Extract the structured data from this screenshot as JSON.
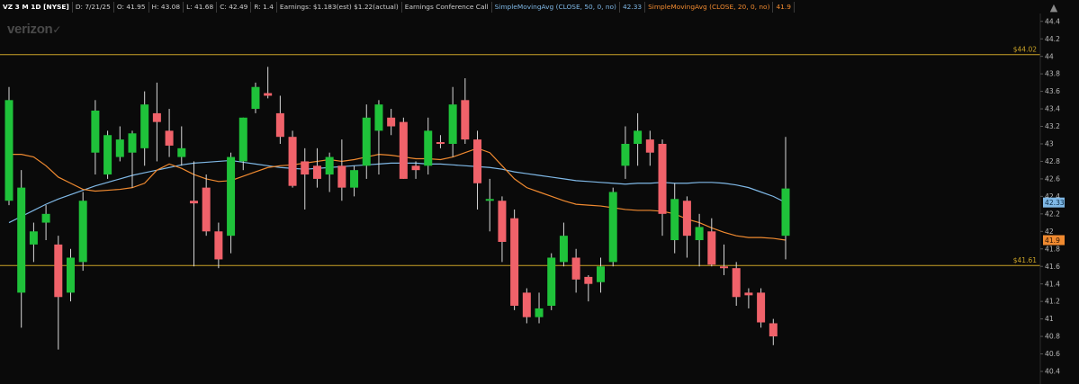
{
  "header": {
    "symbol": "VZ 3 M 1D [NYSE]",
    "date": "D: 7/21/25",
    "open": "O: 41.95",
    "high": "H: 43.08",
    "low": "L: 41.68",
    "close": "C: 42.49",
    "range": "R: 1.4",
    "earnings": "Earnings: $1.183(est) $1.22(actual)",
    "conference": "Earnings Conference Call",
    "sma50_label": "SimpleMovingAvg (CLOSE, 50, 0, no)",
    "sma50_value": "42.33",
    "sma20_label": "SimpleMovingAvg (CLOSE, 20, 0, no)",
    "sma20_value": "41.9"
  },
  "logo": {
    "text": "verizon",
    "mark": "✓"
  },
  "colors": {
    "up": "#1fc23a",
    "down": "#f0626a",
    "sma50": "#7fb8e6",
    "sma20": "#f08a30",
    "level": "#c9a227",
    "background": "#0a0a0a",
    "axis_text": "#b8b8b8"
  },
  "chart_data": {
    "type": "candlestick",
    "ylim": [
      40.4,
      44.5
    ],
    "y_ticks": [
      "44.4",
      "44.2",
      "44",
      "43.8",
      "43.6",
      "43.4",
      "43.2",
      "43",
      "42.8",
      "42.6",
      "42.4",
      "42.2",
      "42",
      "41.8",
      "41.6",
      "41.4",
      "41.2",
      "41",
      "40.8",
      "40.6",
      "40.4"
    ],
    "horizontal_lines": [
      {
        "value": 44.02,
        "label": "$44.02"
      },
      {
        "value": 41.61,
        "label": "$41.61"
      }
    ],
    "last_value_labels": [
      {
        "value": 42.33,
        "label": "42.33",
        "series": "sma50"
      },
      {
        "value": 41.9,
        "label": "41.9",
        "series": "sma20"
      }
    ],
    "candles": [
      {
        "o": 42.35,
        "h": 43.65,
        "l": 42.3,
        "c": 43.5
      },
      {
        "o": 41.3,
        "h": 42.7,
        "l": 40.9,
        "c": 42.5
      },
      {
        "o": 41.85,
        "h": 42.1,
        "l": 41.65,
        "c": 42.0
      },
      {
        "o": 42.1,
        "h": 42.3,
        "l": 41.9,
        "c": 42.2
      },
      {
        "o": 41.85,
        "h": 41.95,
        "l": 40.65,
        "c": 41.25
      },
      {
        "o": 41.3,
        "h": 41.8,
        "l": 41.2,
        "c": 41.7
      },
      {
        "o": 41.65,
        "h": 42.45,
        "l": 41.55,
        "c": 42.35
      },
      {
        "o": 42.9,
        "h": 43.5,
        "l": 42.65,
        "c": 43.38
      },
      {
        "o": 42.65,
        "h": 43.15,
        "l": 42.6,
        "c": 43.1
      },
      {
        "o": 42.85,
        "h": 43.2,
        "l": 42.8,
        "c": 43.05
      },
      {
        "o": 42.9,
        "h": 43.15,
        "l": 42.5,
        "c": 43.12
      },
      {
        "o": 42.95,
        "h": 43.6,
        "l": 42.75,
        "c": 43.45
      },
      {
        "o": 43.35,
        "h": 43.7,
        "l": 42.8,
        "c": 43.25
      },
      {
        "o": 43.15,
        "h": 43.4,
        "l": 42.85,
        "c": 42.98
      },
      {
        "o": 42.85,
        "h": 43.2,
        "l": 42.75,
        "c": 42.95
      },
      {
        "o": 42.35,
        "h": 42.8,
        "l": 41.6,
        "c": 42.32
      },
      {
        "o": 42.5,
        "h": 42.65,
        "l": 41.95,
        "c": 42.0
      },
      {
        "o": 42.0,
        "h": 42.1,
        "l": 41.58,
        "c": 41.68
      },
      {
        "o": 41.95,
        "h": 42.9,
        "l": 41.75,
        "c": 42.85
      },
      {
        "o": 42.8,
        "h": 43.3,
        "l": 42.7,
        "c": 43.3
      },
      {
        "o": 43.4,
        "h": 43.7,
        "l": 43.35,
        "c": 43.65
      },
      {
        "o": 43.58,
        "h": 43.88,
        "l": 43.52,
        "c": 43.55
      },
      {
        "o": 43.35,
        "h": 43.55,
        "l": 43.0,
        "c": 43.08
      },
      {
        "o": 43.08,
        "h": 43.15,
        "l": 42.5,
        "c": 42.52
      },
      {
        "o": 42.8,
        "h": 42.95,
        "l": 42.25,
        "c": 42.65
      },
      {
        "o": 42.75,
        "h": 42.95,
        "l": 42.5,
        "c": 42.6
      },
      {
        "o": 42.65,
        "h": 42.9,
        "l": 42.45,
        "c": 42.85
      },
      {
        "o": 42.75,
        "h": 43.05,
        "l": 42.35,
        "c": 42.5
      },
      {
        "o": 42.5,
        "h": 42.75,
        "l": 42.4,
        "c": 42.7
      },
      {
        "o": 42.75,
        "h": 43.45,
        "l": 42.6,
        "c": 43.3
      },
      {
        "o": 43.15,
        "h": 43.5,
        "l": 42.65,
        "c": 43.45
      },
      {
        "o": 43.3,
        "h": 43.4,
        "l": 43.1,
        "c": 43.2
      },
      {
        "o": 43.25,
        "h": 43.3,
        "l": 42.6,
        "c": 42.6
      },
      {
        "o": 42.75,
        "h": 42.8,
        "l": 42.6,
        "c": 42.7
      },
      {
        "o": 42.75,
        "h": 43.3,
        "l": 42.65,
        "c": 43.15
      },
      {
        "o": 43.02,
        "h": 43.1,
        "l": 42.95,
        "c": 43.0
      },
      {
        "o": 43.0,
        "h": 43.65,
        "l": 42.85,
        "c": 43.45
      },
      {
        "o": 43.5,
        "h": 43.75,
        "l": 43.0,
        "c": 43.05
      },
      {
        "o": 43.05,
        "h": 43.15,
        "l": 42.25,
        "c": 42.55
      },
      {
        "o": 42.35,
        "h": 42.6,
        "l": 42.0,
        "c": 42.37
      },
      {
        "o": 42.35,
        "h": 42.4,
        "l": 41.65,
        "c": 41.88
      },
      {
        "o": 42.15,
        "h": 42.25,
        "l": 41.1,
        "c": 41.15
      },
      {
        "o": 41.3,
        "h": 41.35,
        "l": 40.95,
        "c": 41.02
      },
      {
        "o": 41.02,
        "h": 41.3,
        "l": 40.95,
        "c": 41.12
      },
      {
        "o": 41.15,
        "h": 41.75,
        "l": 41.1,
        "c": 41.7
      },
      {
        "o": 41.65,
        "h": 42.1,
        "l": 41.6,
        "c": 41.95
      },
      {
        "o": 41.7,
        "h": 41.8,
        "l": 41.3,
        "c": 41.45
      },
      {
        "o": 41.48,
        "h": 41.5,
        "l": 41.2,
        "c": 41.4
      },
      {
        "o": 41.42,
        "h": 41.7,
        "l": 41.3,
        "c": 41.6
      },
      {
        "o": 41.65,
        "h": 42.5,
        "l": 41.6,
        "c": 42.45
      },
      {
        "o": 42.75,
        "h": 43.2,
        "l": 42.6,
        "c": 43.0
      },
      {
        "o": 43.0,
        "h": 43.35,
        "l": 42.75,
        "c": 43.15
      },
      {
        "o": 43.05,
        "h": 43.15,
        "l": 42.75,
        "c": 42.9
      },
      {
        "o": 43.0,
        "h": 43.05,
        "l": 41.95,
        "c": 42.2
      },
      {
        "o": 41.9,
        "h": 42.55,
        "l": 41.75,
        "c": 42.37
      },
      {
        "o": 42.35,
        "h": 42.4,
        "l": 41.7,
        "c": 41.95
      },
      {
        "o": 41.9,
        "h": 42.2,
        "l": 41.6,
        "c": 42.05
      },
      {
        "o": 42.0,
        "h": 42.15,
        "l": 41.6,
        "c": 41.62
      },
      {
        "o": 41.6,
        "h": 41.85,
        "l": 41.5,
        "c": 41.58
      },
      {
        "o": 41.58,
        "h": 41.65,
        "l": 41.15,
        "c": 41.25
      },
      {
        "o": 41.3,
        "h": 41.35,
        "l": 41.12,
        "c": 41.27
      },
      {
        "o": 41.3,
        "h": 41.35,
        "l": 40.9,
        "c": 40.96
      },
      {
        "o": 40.95,
        "h": 41.0,
        "l": 40.7,
        "c": 40.8
      },
      {
        "o": 41.95,
        "h": 43.08,
        "l": 41.68,
        "c": 42.49
      }
    ],
    "sma50": [
      42.1,
      42.17,
      42.24,
      42.31,
      42.37,
      42.42,
      42.47,
      42.52,
      42.56,
      42.6,
      42.64,
      42.67,
      42.7,
      42.73,
      42.76,
      42.78,
      42.79,
      42.8,
      42.81,
      42.79,
      42.77,
      42.75,
      42.73,
      42.72,
      42.71,
      42.72,
      42.73,
      42.74,
      42.75,
      42.76,
      42.77,
      42.78,
      42.78,
      42.78,
      42.77,
      42.77,
      42.76,
      42.75,
      42.74,
      42.73,
      42.71,
      42.68,
      42.66,
      42.64,
      42.62,
      42.6,
      42.58,
      42.57,
      42.56,
      42.55,
      42.54,
      42.55,
      42.55,
      42.56,
      42.55,
      42.55,
      42.56,
      42.56,
      42.55,
      42.53,
      42.5,
      42.45,
      42.4,
      42.33
    ],
    "sma20": [
      42.88,
      42.88,
      42.85,
      42.75,
      42.62,
      42.55,
      42.48,
      42.46,
      42.47,
      42.48,
      42.5,
      42.55,
      42.7,
      42.77,
      42.72,
      42.65,
      42.6,
      42.57,
      42.58,
      42.63,
      42.68,
      42.73,
      42.75,
      42.76,
      42.78,
      42.8,
      42.82,
      42.8,
      42.82,
      42.85,
      42.88,
      42.87,
      42.85,
      42.83,
      42.83,
      42.82,
      42.85,
      42.9,
      42.95,
      42.9,
      42.75,
      42.6,
      42.5,
      42.45,
      42.4,
      42.35,
      42.31,
      42.3,
      42.29,
      42.27,
      42.25,
      42.24,
      42.24,
      42.23,
      42.2,
      42.14,
      42.1,
      42.04,
      41.99,
      41.95,
      41.93,
      41.93,
      41.92,
      41.9
    ]
  }
}
